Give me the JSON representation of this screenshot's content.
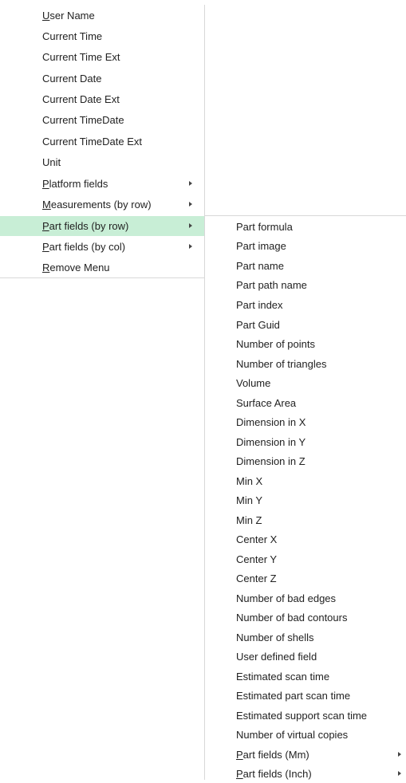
{
  "menu": {
    "items": [
      {
        "label": "User Name",
        "has_submenu": false,
        "selected": false
      },
      {
        "label": "Current Time",
        "has_submenu": false,
        "selected": false
      },
      {
        "label": "Current Time Ext",
        "has_submenu": false,
        "selected": false
      },
      {
        "label": "Current Date",
        "has_submenu": false,
        "selected": false
      },
      {
        "label": "Current Date Ext",
        "has_submenu": false,
        "selected": false
      },
      {
        "label": "Current TimeDate",
        "has_submenu": false,
        "selected": false
      },
      {
        "label": "Current TimeDate Ext",
        "has_submenu": false,
        "selected": false
      },
      {
        "label": "Unit",
        "has_submenu": false,
        "selected": false
      },
      {
        "label": "Platform fields",
        "has_submenu": true,
        "selected": false
      },
      {
        "label": "Measurements (by row)",
        "has_submenu": true,
        "selected": false
      },
      {
        "label": "Part fields (by row)",
        "has_submenu": true,
        "selected": true
      },
      {
        "label": "Part fields (by col)",
        "has_submenu": true,
        "selected": false
      },
      {
        "label": "Remove Menu",
        "has_submenu": false,
        "selected": false
      }
    ]
  },
  "submenu": {
    "items": [
      {
        "label": "Part formula",
        "has_submenu": false
      },
      {
        "label": "Part image",
        "has_submenu": false
      },
      {
        "label": "Part name",
        "has_submenu": false
      },
      {
        "label": "Part path name",
        "has_submenu": false
      },
      {
        "label": "Part index",
        "has_submenu": false
      },
      {
        "label": "Part Guid",
        "has_submenu": false
      },
      {
        "label": "Number of points",
        "has_submenu": false
      },
      {
        "label": "Number of triangles",
        "has_submenu": false
      },
      {
        "label": "Volume",
        "has_submenu": false
      },
      {
        "label": "Surface Area",
        "has_submenu": false
      },
      {
        "label": "Dimension in X",
        "has_submenu": false
      },
      {
        "label": "Dimension in Y",
        "has_submenu": false
      },
      {
        "label": "Dimension in Z",
        "has_submenu": false
      },
      {
        "label": "Min X",
        "has_submenu": false
      },
      {
        "label": "Min Y",
        "has_submenu": false
      },
      {
        "label": "Min Z",
        "has_submenu": false
      },
      {
        "label": "Center X",
        "has_submenu": false
      },
      {
        "label": "Center Y",
        "has_submenu": false
      },
      {
        "label": "Center Z",
        "has_submenu": false
      },
      {
        "label": "Number of bad edges",
        "has_submenu": false
      },
      {
        "label": "Number of bad contours",
        "has_submenu": false
      },
      {
        "label": "Number of shells",
        "has_submenu": false
      },
      {
        "label": "User defined field",
        "has_submenu": false
      },
      {
        "label": "Estimated scan time",
        "has_submenu": false
      },
      {
        "label": "Estimated part scan time",
        "has_submenu": false
      },
      {
        "label": "Estimated support scan time",
        "has_submenu": false
      },
      {
        "label": "Number of virtual copies",
        "has_submenu": false
      },
      {
        "label": "Part fields (Mm)",
        "has_submenu": true
      },
      {
        "label": "Part fields (Inch)",
        "has_submenu": true
      }
    ]
  },
  "colors": {
    "selected_bg": "#c8eed6",
    "border": "#d8d8d8",
    "text": "#222222"
  },
  "icons": {
    "submenu_arrow": "chevron-right-icon"
  }
}
